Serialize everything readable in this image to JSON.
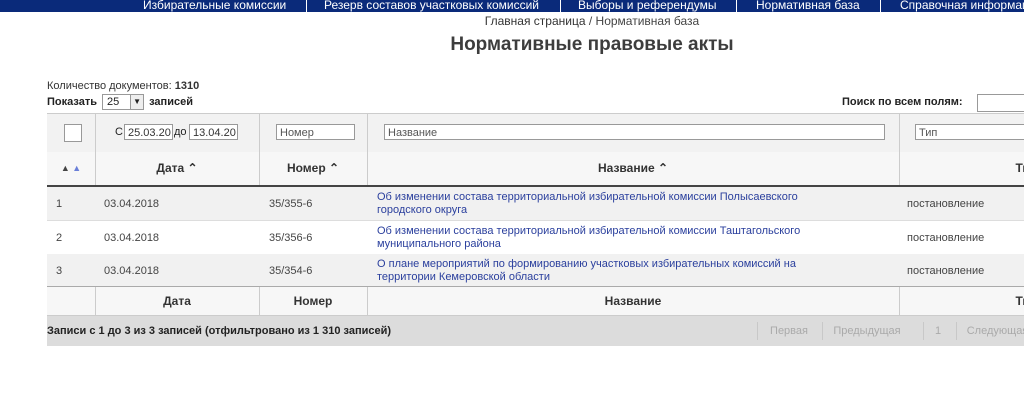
{
  "nav": {
    "items": [
      "Избирательные комиссии",
      "Резерв составов участковых комиссий",
      "Выборы и референдумы",
      "Нормативная база",
      "Справочная информация"
    ]
  },
  "breadcrumb": {
    "home": "Главная страница",
    "separator": "/",
    "current": "Нормативная база"
  },
  "page": {
    "title": "Нормативные правовые акты"
  },
  "summary": {
    "count_label": "Количество документов:",
    "count_value": "1310"
  },
  "length": {
    "label_before": "Показать",
    "value": "25",
    "label_after": "записей"
  },
  "search": {
    "label": "Поиск по всем полям:"
  },
  "filters": {
    "date_from_label": "С",
    "date_from": "25.03.20",
    "date_to_label": "до",
    "date_to": "13.04.20",
    "number_placeholder": "Номер",
    "name_placeholder": "Название",
    "type_placeholder": "Тип"
  },
  "table": {
    "sort_indicator": "▲",
    "headers": {
      "date": "Дата ⌃",
      "number": "Номер ⌃",
      "name": "Название ⌃",
      "type": "Тип"
    },
    "rows": [
      {
        "n": "1",
        "date": "03.04.2018",
        "number": "35/355-6",
        "name": "Об изменении состава территориальной избирательной комиссии Полысаевского городского округа",
        "type": "постановление"
      },
      {
        "n": "2",
        "date": "03.04.2018",
        "number": "35/356-6",
        "name": "Об изменении состава территориальной избирательной комиссии Таштагольского муниципального района",
        "type": "постановление"
      },
      {
        "n": "3",
        "date": "03.04.2018",
        "number": "35/354-6",
        "name": "О плане мероприятий по формированию участковых избирательных комиссий на территории Кемеровской области",
        "type": "постановление"
      }
    ],
    "footers": {
      "date": "Дата",
      "number": "Номер",
      "name": "Название",
      "type": "Тип"
    }
  },
  "info": {
    "text": "Записи с 1 до 3 из 3 записей (отфильтровано из 1 310 записей)"
  },
  "pagination": {
    "first": "Первая",
    "prev": "Предыдущая",
    "page": "1",
    "next": "Следующая"
  }
}
